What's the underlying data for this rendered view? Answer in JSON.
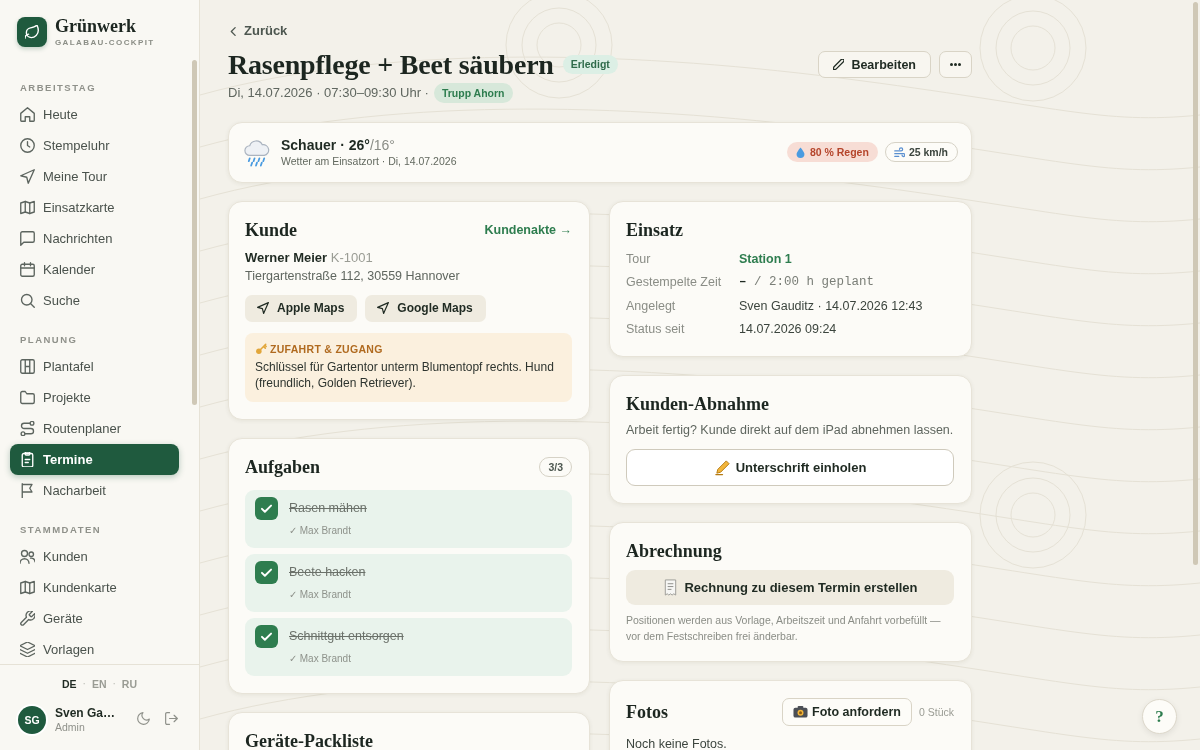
{
  "brand": {
    "name": "Grünwerk",
    "subtitle": "GALABAU-COCKPIT"
  },
  "sidebar": {
    "sections": [
      {
        "title": "ARBEITSTAG",
        "items": [
          {
            "label": "Heute",
            "selected": false
          },
          {
            "label": "Stempeluhr",
            "selected": false
          },
          {
            "label": "Meine Tour",
            "selected": false
          },
          {
            "label": "Einsatzkarte",
            "selected": false
          },
          {
            "label": "Nachrichten",
            "selected": false
          },
          {
            "label": "Kalender",
            "selected": false
          },
          {
            "label": "Suche",
            "selected": false
          }
        ]
      },
      {
        "title": "PLANUNG",
        "items": [
          {
            "label": "Plantafel",
            "selected": false
          },
          {
            "label": "Projekte",
            "selected": false
          },
          {
            "label": "Routenplaner",
            "selected": false
          },
          {
            "label": "Termine",
            "selected": true
          },
          {
            "label": "Nacharbeit",
            "selected": false
          }
        ]
      },
      {
        "title": "STAMMDATEN",
        "items": [
          {
            "label": "Kunden",
            "selected": false
          },
          {
            "label": "Kundenkarte",
            "selected": false
          },
          {
            "label": "Geräte",
            "selected": false
          },
          {
            "label": "Vorlagen",
            "selected": false
          }
        ]
      }
    ],
    "languages": {
      "separator": "·",
      "items": [
        {
          "code": "DE",
          "selected": true
        },
        {
          "code": "EN",
          "selected": false
        },
        {
          "code": "RU",
          "selected": false
        }
      ]
    },
    "user": {
      "initials": "SG",
      "name": "Sven Ga…",
      "role": "Admin"
    }
  },
  "header": {
    "back": "Zurück",
    "title": "Rasenpflege + Beet säubern",
    "status": "Erledigt",
    "meta": "Di, 14.07.2026 · 07:30–09:30 Uhr ·",
    "crew": "Trupp Ahorn",
    "edit_button": "Bearbeiten"
  },
  "weather": {
    "condition": "Schauer · 26°",
    "low": "/16°",
    "subtitle": "Wetter am Einsatzort · Di, 14.07.2026",
    "rain": "80 % Regen",
    "wind": "25 km/h"
  },
  "customer": {
    "title": "Kunde",
    "link": "Kundenakte →",
    "name": "Werner Meier",
    "number": "K-1001",
    "address": "Tiergartenstraße 112, 30559 Hannover",
    "map_buttons": [
      "Apple Maps",
      "Google Maps"
    ],
    "access": {
      "title": "ZUFAHRT & ZUGANG",
      "text": "Schlüssel für Gartentor unterm Blumentopf rechts. Hund (freundlich, Golden Retriever)."
    }
  },
  "tasks": {
    "title": "Aufgaben",
    "count": "3/3",
    "items": [
      {
        "label": "Rasen mähen",
        "done_by": "✓ Max Brandt",
        "checked": true
      },
      {
        "label": "Beete hacken",
        "done_by": "✓ Max Brandt",
        "checked": true
      },
      {
        "label": "Schnittgut entsorgen",
        "done_by": "✓ Max Brandt",
        "checked": true
      }
    ]
  },
  "equipment": {
    "title": "Geräte-Packliste"
  },
  "deployment": {
    "title": "Einsatz",
    "rows": [
      {
        "label": "Tour",
        "value": "Station 1",
        "kind": "link"
      },
      {
        "label": "Gestempelte Zeit",
        "value": "**–** / 2:00 h geplant",
        "kind": "mono"
      },
      {
        "label": "Angelegt",
        "value": "Sven Gauditz · 14.07.2026 12:43",
        "kind": "text"
      },
      {
        "label": "Status seit",
        "value": "14.07.2026 09:24",
        "kind": "text"
      }
    ]
  },
  "acceptance": {
    "title": "Kunden-Abnahme",
    "text": "Arbeit fertig? Kunde direkt auf dem iPad abnehmen lassen.",
    "button": "Unterschrift einholen"
  },
  "billing": {
    "title": "Abrechnung",
    "button": "Rechnung zu diesem Termin erstellen",
    "note": "Positionen werden aus Vorlage, Arbeitszeit und Anfahrt vorbefüllt — vor dem Festschreiben frei änderbar."
  },
  "photos": {
    "title": "Fotos",
    "button": "Foto anfordern",
    "count": "0 Stück",
    "empty": "Noch keine Fotos."
  },
  "help_button": "?"
}
